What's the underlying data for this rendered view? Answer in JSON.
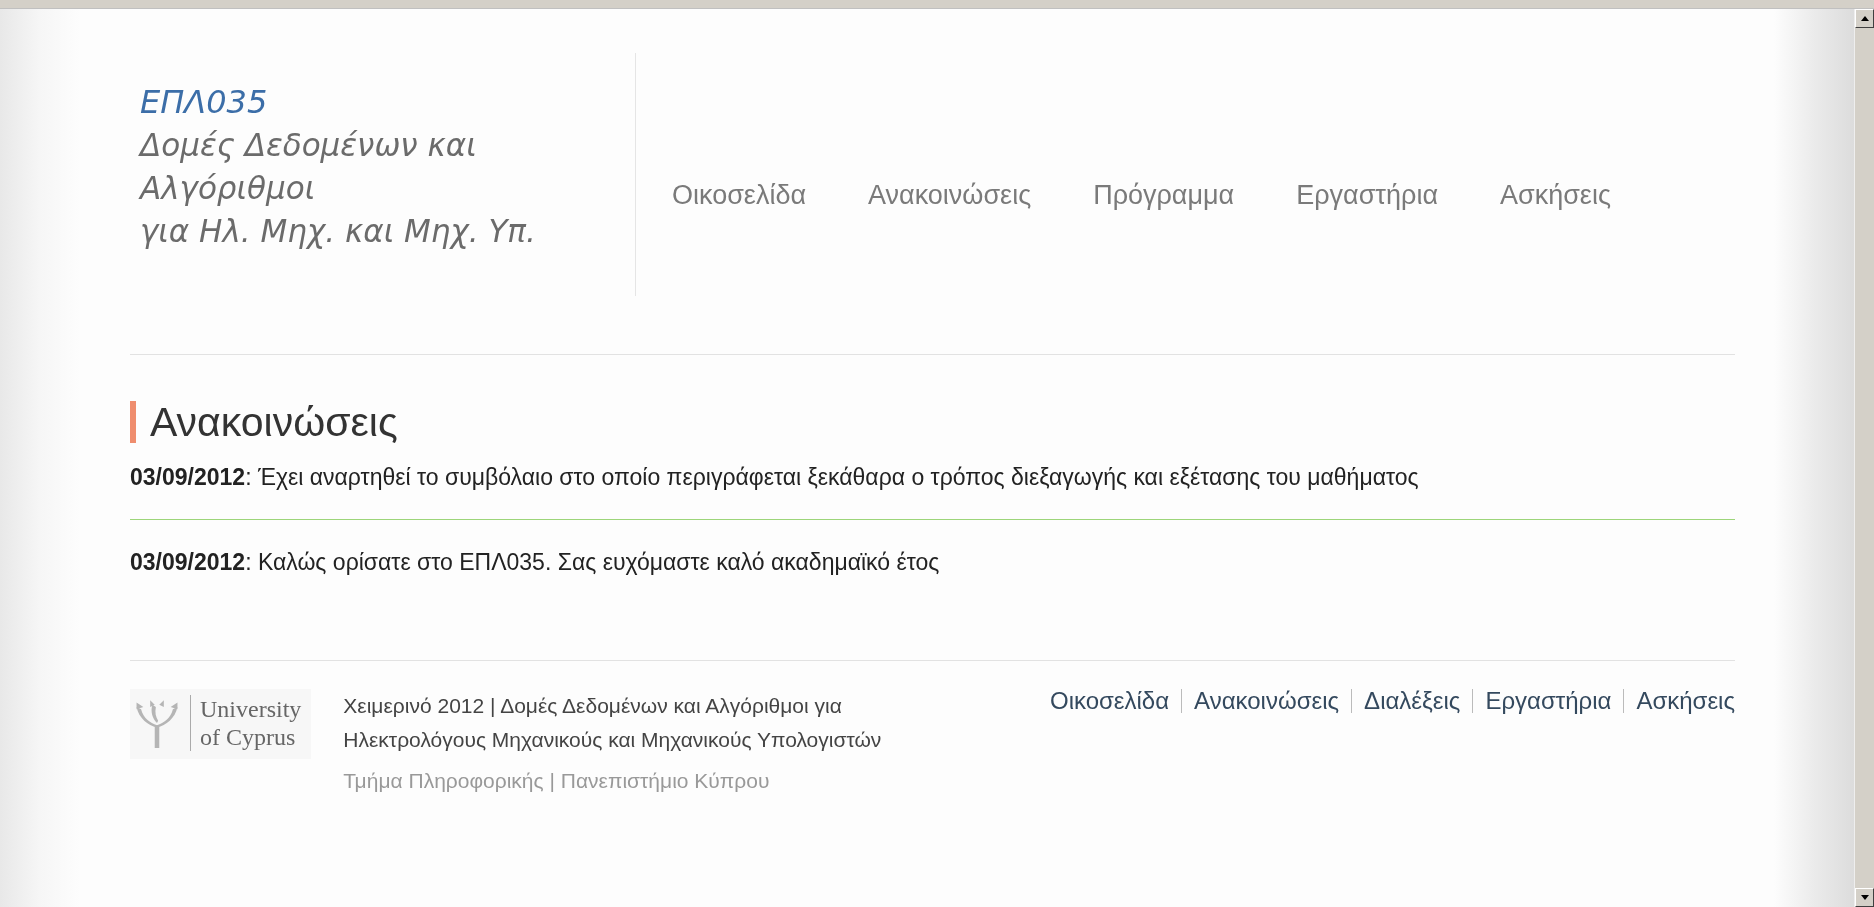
{
  "header": {
    "code": "ΕΠΛ035",
    "title_lines": [
      "Δομές Δεδομένων και",
      "Αλγόριθμοι",
      "για Ηλ. Μηχ. και Μηχ. Υπ."
    ]
  },
  "nav": [
    {
      "label": "Οικοσελίδα"
    },
    {
      "label": "Ανακοινώσεις"
    },
    {
      "label": "Πρόγραμμα"
    },
    {
      "label": "Εργαστήρια"
    },
    {
      "label": "Ασκήσεις"
    }
  ],
  "section_title": "Ανακοινώσεις",
  "announcements": [
    {
      "text": "**03/09/2012**: Έχει αναρτηθεί το συμβόλαιο στο οποίο περιγράφεται ξεκάθαρα ο τρόπος διεξαγωγής και εξέτασης του μαθήματος"
    },
    {
      "text": "**03/09/2012**: Καλώς ορίσατε στο ΕΠΛ035. Σας ευχόμαστε καλό ακαδημαϊκό έτος"
    }
  ],
  "footer": {
    "logo_lines": [
      "University",
      "of Cyprus"
    ],
    "lines": [
      "Χειμερινό 2012 | Δομές Δεδομένων και Αλγόριθμοι για",
      "Ηλεκτρολόγους Μηχανικούς και Μηχανικούς Υπολογιστών"
    ],
    "department": "Τμήμα Πληροφορικής | Πανεπιστήμιο Κύπρου",
    "links": [
      {
        "label": "Οικοσελίδα"
      },
      {
        "label": "Ανακοινώσεις"
      },
      {
        "label": "Διαλέξεις"
      },
      {
        "label": "Εργαστήρια"
      },
      {
        "label": "Ασκήσεις"
      }
    ]
  }
}
